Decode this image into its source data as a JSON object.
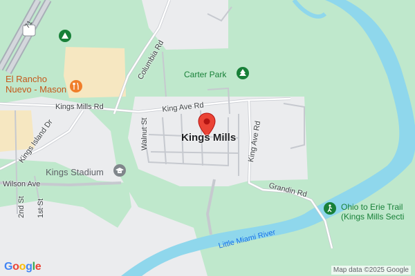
{
  "map": {
    "town_label": "Kings Mills",
    "park_label": "Carter Park",
    "stadium_label": "Kings Stadium",
    "restaurant_label_line1": "El Rancho",
    "restaurant_label_line2": "Nuevo - Mason",
    "trail_label_line1": "Ohio to Erie Trail",
    "trail_label_line2": "(Kings Mills Secti",
    "river_label": "Little Miami River",
    "highway_shield": "71",
    "roads": {
      "columbia_rd": "Columbia Rd",
      "kings_mills_rd": "Kings Mills Rd",
      "king_ave_rd_1": "King Ave Rd",
      "king_ave_rd_2": "King Ave Rd",
      "kings_island_dr": "Kings Island Dr",
      "walnut_st": "Walnut St",
      "wilson_ave": "Wilson Ave",
      "second_st": "2nd St",
      "first_st": "1st St",
      "grandin_rd": "Grandin Rd"
    },
    "colors": {
      "park_green": "#bfe8cc",
      "water_blue": "#8fd7ec",
      "land_gray": "#ebecee",
      "commercial_tan": "#f6e7c1",
      "pin_red": "#ea4335"
    }
  },
  "footer": {
    "logo_text": "Google",
    "attribution": "Map data ©2025 Google"
  }
}
